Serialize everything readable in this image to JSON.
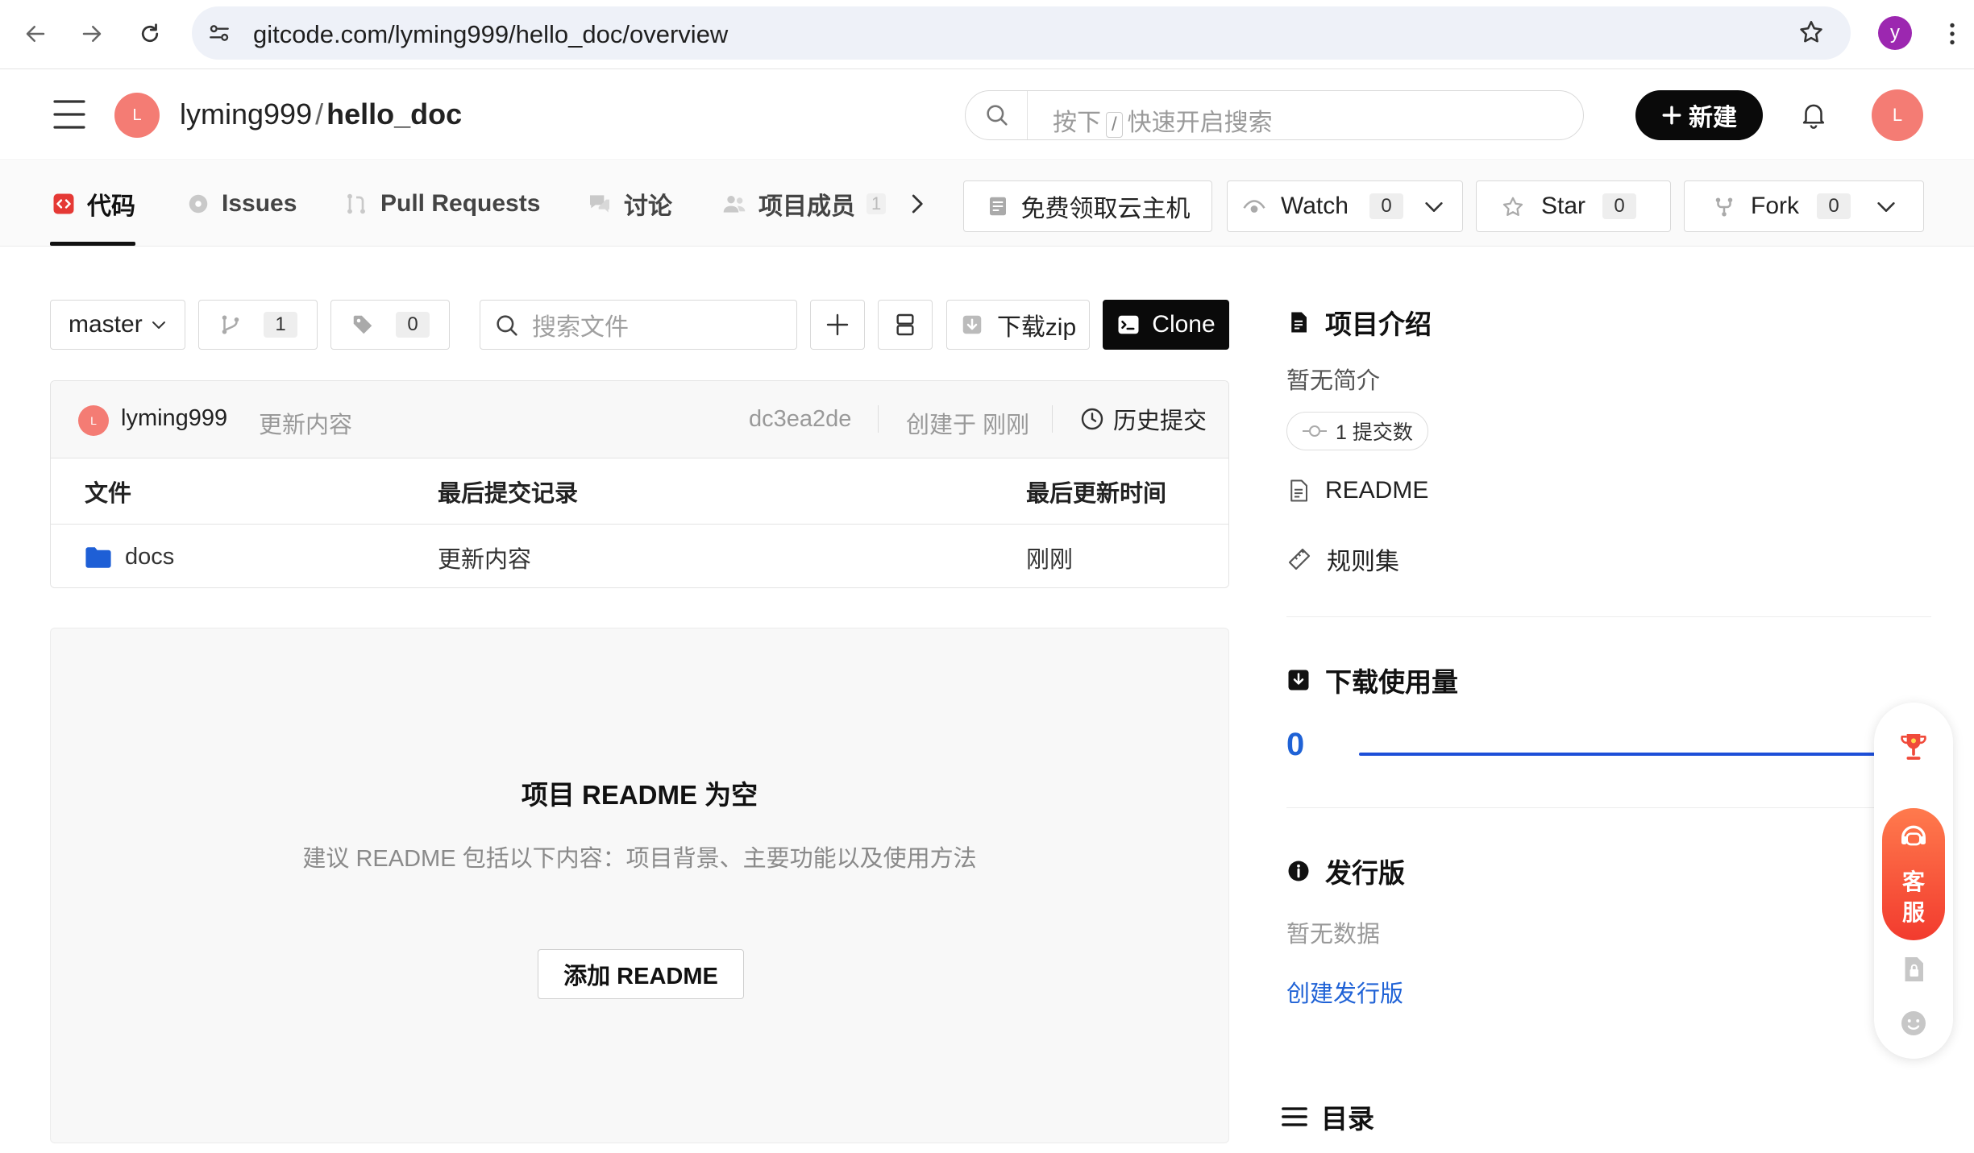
{
  "browser": {
    "url": "gitcode.com/lyming999/hello_doc/overview",
    "profile_initial": "y"
  },
  "header": {
    "avatar_initial": "L",
    "owner": "lyming999",
    "separator": "/",
    "repo": "hello_doc",
    "search_prefix": "按下",
    "search_key": "/",
    "search_suffix": "快速开启搜索",
    "new_label": "新建",
    "user_initial": "L"
  },
  "tabs": {
    "code": "代码",
    "issues": "Issues",
    "pull_requests": "Pull Requests",
    "discussions": "讨论",
    "members": "项目成员",
    "members_count": "1"
  },
  "actions": {
    "cloud": "免费领取云主机",
    "watch": "Watch",
    "watch_count": "0",
    "star": "Star",
    "star_count": "0",
    "fork": "Fork",
    "fork_count": "0"
  },
  "toolbar": {
    "branch": "master",
    "branch_count": "1",
    "tag_count": "0",
    "search_placeholder": "搜索文件",
    "download_zip": "下载zip",
    "clone": "Clone"
  },
  "commit": {
    "avatar_initial": "L",
    "author": "lyming999",
    "message": "更新内容",
    "hash": "dc3ea2de",
    "created": "创建于 刚刚",
    "history": "历史提交"
  },
  "table": {
    "columns": [
      "文件",
      "最后提交记录",
      "最后更新时间"
    ],
    "rows": [
      {
        "name": "docs",
        "commit": "更新内容",
        "time": "刚刚"
      }
    ]
  },
  "readme": {
    "title": "项目 README 为空",
    "hint": "建议 README 包括以下内容：项目背景、主要功能以及使用方法",
    "add_button": "添加 README"
  },
  "sidebar": {
    "intro_title": "项目介绍",
    "intro_text": "暂无简介",
    "commits_badge": "1 提交数",
    "readme_link": "README",
    "rules_link": "规则集",
    "downloads_title": "下载使用量",
    "downloads_value": "0",
    "releases_title": "发行版",
    "releases_text": "暂无数据",
    "create_release": "创建发行版",
    "toc_title": "目录"
  },
  "float": {
    "service_line1": "客",
    "service_line2": "服"
  },
  "colors": {
    "accent_red": "#f0404b",
    "link_blue": "#1f62d6",
    "chart_blue": "#1d4fd8",
    "avatar_coral": "#f47c74"
  }
}
